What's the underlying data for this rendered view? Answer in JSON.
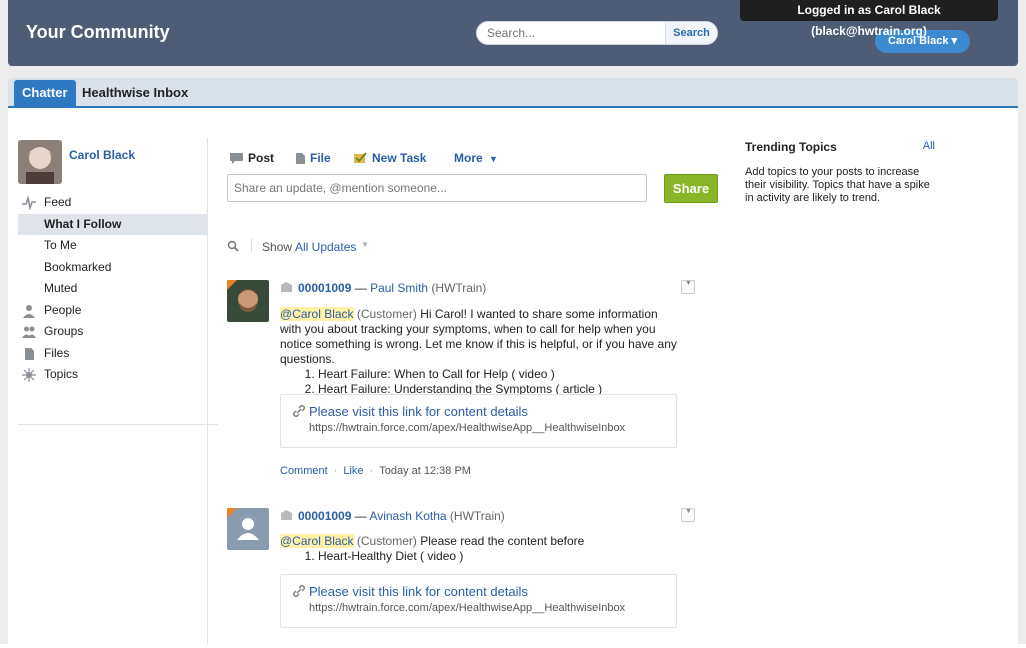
{
  "header": {
    "brand": "Your Community",
    "search_placeholder": "Search...",
    "search_button": "Search",
    "login_status": "Logged in as Carol Black (black@hwtrain.org)",
    "user_menu": "Carol Black ▾"
  },
  "tabs": [
    "Chatter",
    "Healthwise Inbox"
  ],
  "sidebar": {
    "profile_name": "Carol Black",
    "items": [
      {
        "label": "Feed",
        "icon": "feed-icon"
      },
      {
        "label": "What I Follow",
        "active": true
      },
      {
        "label": "To Me"
      },
      {
        "label": "Bookmarked"
      },
      {
        "label": "Muted"
      },
      {
        "label": "People",
        "icon": "people-icon"
      },
      {
        "label": "Groups",
        "icon": "groups-icon"
      },
      {
        "label": "Files",
        "icon": "files-icon"
      },
      {
        "label": "Topics",
        "icon": "topics-icon"
      }
    ]
  },
  "publisher": {
    "post": "Post",
    "file": "File",
    "new_task": "New Task",
    "more": "More",
    "placeholder": "Share an update, @mention someone...",
    "share": "Share"
  },
  "filter": {
    "show_label": "Show",
    "show_value": "All Updates"
  },
  "feed": [
    {
      "case": "00001009",
      "dash": " — ",
      "author": "Paul Smith",
      "org": " (HWTrain)",
      "mention": "@Carol Black",
      "mention_role": " (Customer)",
      "text": " Hi Carol! I wanted to share some information with you about tracking your symptoms, when to call for help when you notice something is wrong. Let me know if this is helpful, or if you have any questions.",
      "list": [
        "Heart Failure: When to Call for Help ( video )",
        "Heart Failure: Understanding the Symptoms ( article )"
      ],
      "link_title": "Please visit this link for content details",
      "link_url": "https://hwtrain.force.com/apex/HealthwiseApp__HealthwiseInbox",
      "comment": "Comment",
      "like": "Like",
      "time": "Today at 12:38 PM"
    },
    {
      "case": "00001009",
      "dash": " — ",
      "author": "Avinash Kotha",
      "org": " (HWTrain)",
      "mention": "@Carol Black",
      "mention_role": " (Customer)",
      "text": " Please read the content before",
      "list": [
        "Heart-Healthy Diet ( video )"
      ],
      "link_title": "Please visit this link for content details",
      "link_url": "https://hwtrain.force.com/apex/HealthwiseApp__HealthwiseInbox"
    }
  ],
  "trending": {
    "title": "Trending Topics",
    "all": "All",
    "text": "Add topics to your posts to increase their visibility. Topics that have a spike in activity are likely to trend."
  },
  "colors": {
    "header_bg": "#4e5d75",
    "accent": "#2f79c2",
    "share_button": "#8ab529",
    "link": "#2a5ea6"
  }
}
